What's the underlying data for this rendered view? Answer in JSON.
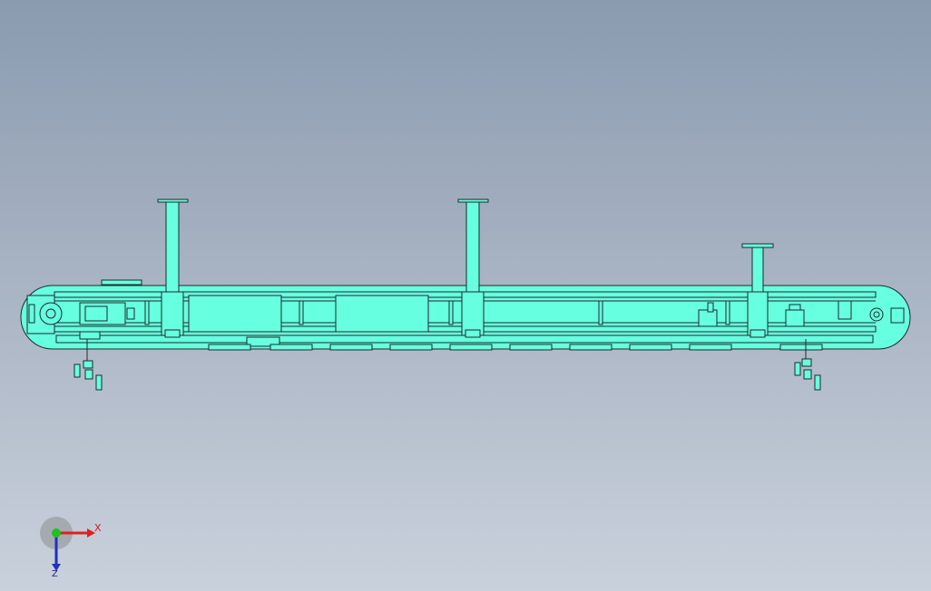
{
  "viewport": {
    "background_top": "#8a9bb0",
    "background_bottom": "#c9d1dc"
  },
  "model": {
    "name_icon": "conveyor-assembly",
    "body_color": "#66ffe0",
    "edge_color": "#1f2a2a",
    "columns": 3,
    "leveling_feet_groups": 2
  },
  "triad": {
    "x_label": "X",
    "z_label": "Z",
    "x_color": "#e02020",
    "y_color": "#20c020",
    "z_color": "#2030c0"
  }
}
